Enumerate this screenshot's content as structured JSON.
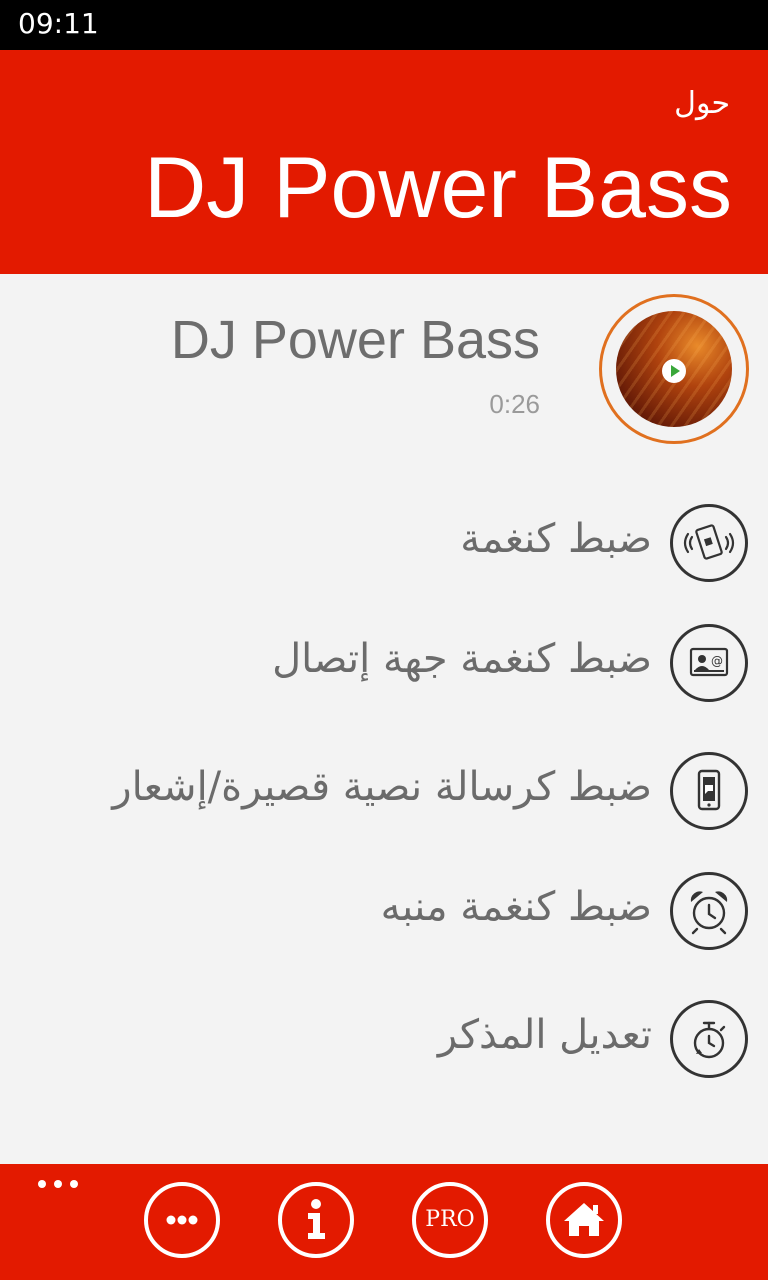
{
  "status_bar": {
    "time": "09:11"
  },
  "header": {
    "subtitle": "حول",
    "title": "DJ Power Bass"
  },
  "track": {
    "title": "DJ Power Bass",
    "duration": "0:26"
  },
  "menu": {
    "items": [
      {
        "label": "ضبط كنغمة",
        "icon": "vibrating-phone-icon"
      },
      {
        "label": "ضبط كنغمة جهة إتصال",
        "icon": "contact-card-icon"
      },
      {
        "label": "ضبط كرسالة نصية قصيرة/إشعار",
        "icon": "phone-message-icon"
      },
      {
        "label": "ضبط كنغمة منبه",
        "icon": "alarm-clock-icon"
      },
      {
        "label": "تعديل المذكر",
        "icon": "stopwatch-icon"
      }
    ]
  },
  "app_bar": {
    "buttons": [
      {
        "name": "more",
        "icon": "more-icon"
      },
      {
        "name": "info",
        "icon": "info-icon"
      },
      {
        "name": "pro",
        "label": "PRO",
        "icon": "pro-icon"
      },
      {
        "name": "home",
        "icon": "home-icon"
      }
    ]
  },
  "colors": {
    "accent": "#e31a00",
    "background": "#f3f3f3",
    "text_primary": "#6d6d6d",
    "album_ring": "#e0701f"
  }
}
